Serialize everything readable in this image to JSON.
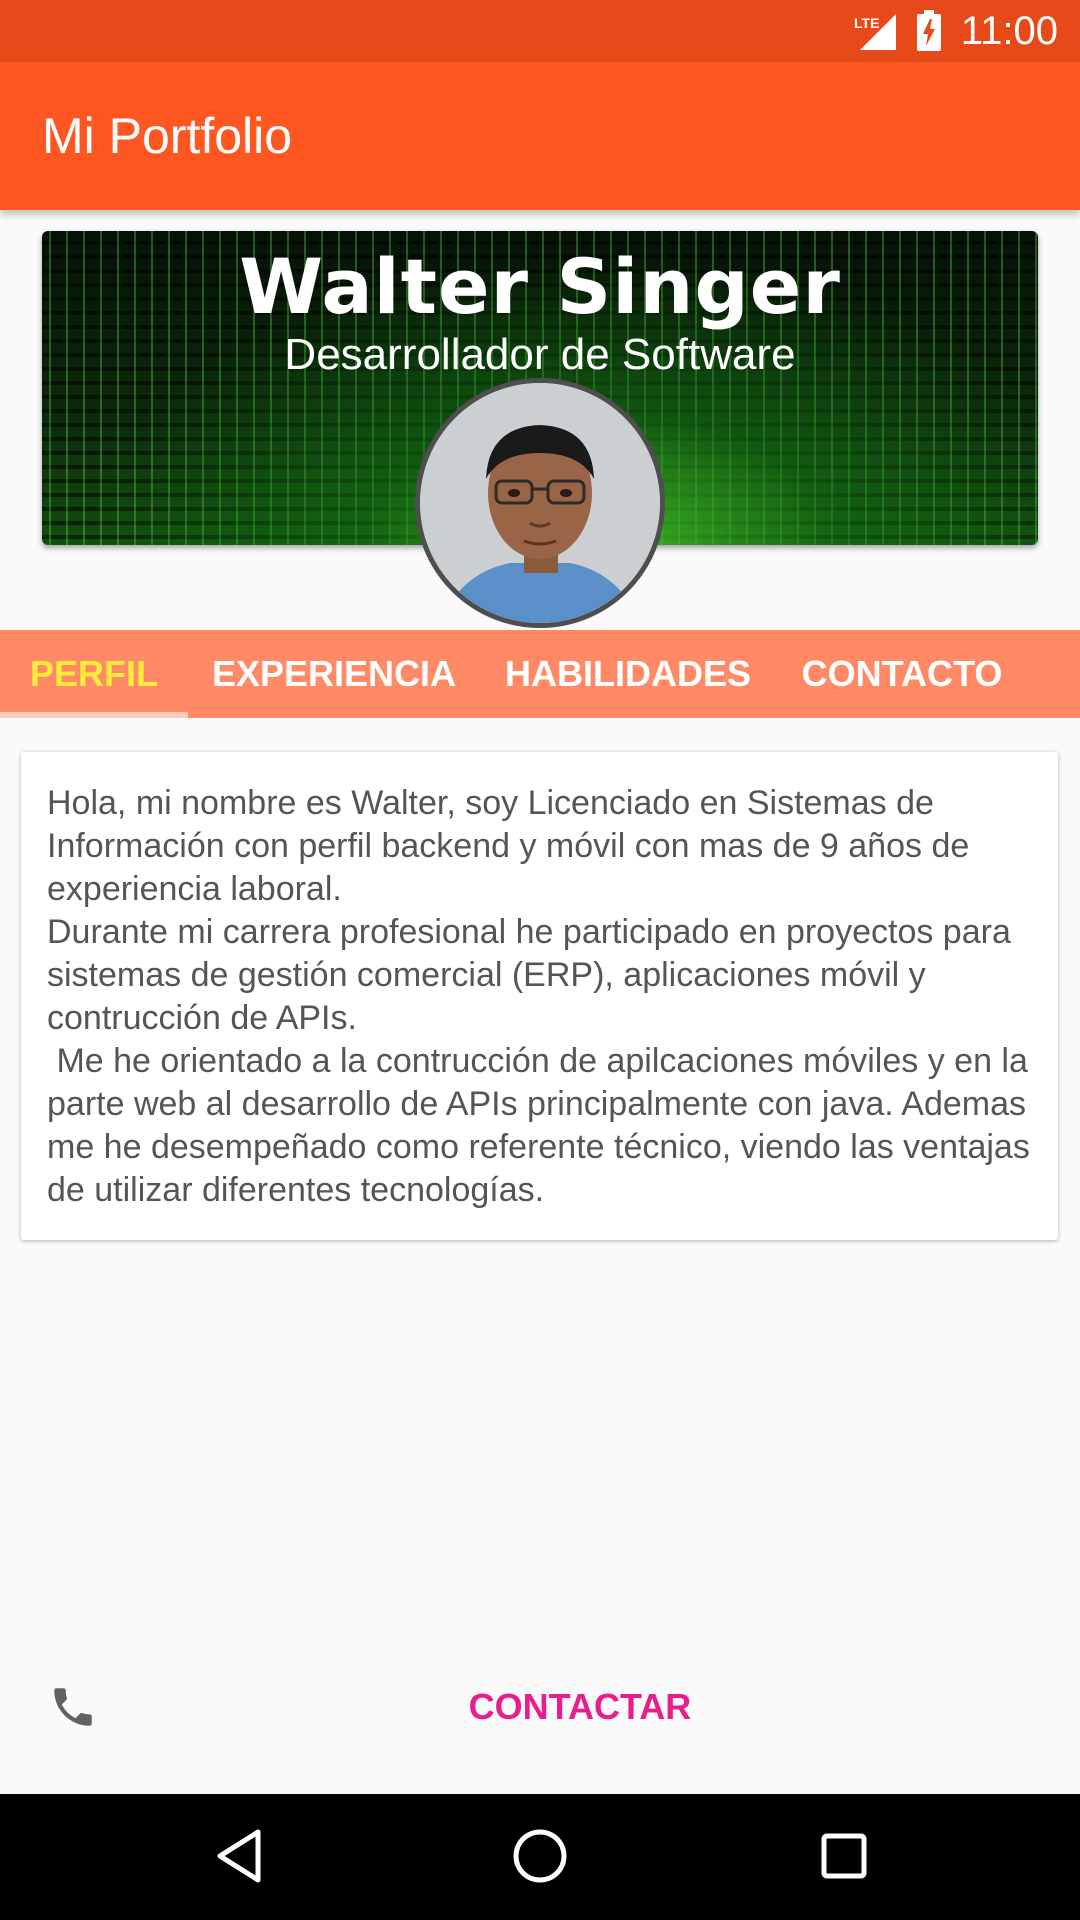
{
  "status_bar": {
    "time": "11:00",
    "network": "LTE",
    "icons": [
      "signal-icon",
      "battery-charging-icon"
    ]
  },
  "app_bar": {
    "title": "Mi Portfolio"
  },
  "header": {
    "name": "Walter Singer",
    "role": "Desarrollador de Software"
  },
  "tabs": [
    {
      "label": "PERFIL",
      "active": true
    },
    {
      "label": "EXPERIENCIA",
      "active": false
    },
    {
      "label": "HABILIDADES",
      "active": false
    },
    {
      "label": "CONTACTO",
      "active": false
    }
  ],
  "profile": {
    "text": "Hola, mi nombre es Walter, soy Licenciado en Sistemas de Información con perfil backend y móvil con mas de 9 años de experiencia laboral.\nDurante mi carrera profesional he participado en proyectos para sistemas de gestión comercial (ERP), aplicaciones móvil y contrucción de APIs.\n Me he orientado a la contrucción de apilcaciones móviles y en la parte web al desarrollo de APIs principalmente con java. Ademas me he desempeñado como referente técnico, viendo las ventajas de utilizar diferentes tecnologías."
  },
  "footer": {
    "contact_label": "CONTACTAR",
    "icon": "phone-icon"
  },
  "colors": {
    "status_bar": "#e64a19",
    "app_bar": "#ff5722",
    "tab_bar": "#ff8a65",
    "tab_active": "#ffeb3b",
    "contact_accent": "#e91e8c"
  }
}
